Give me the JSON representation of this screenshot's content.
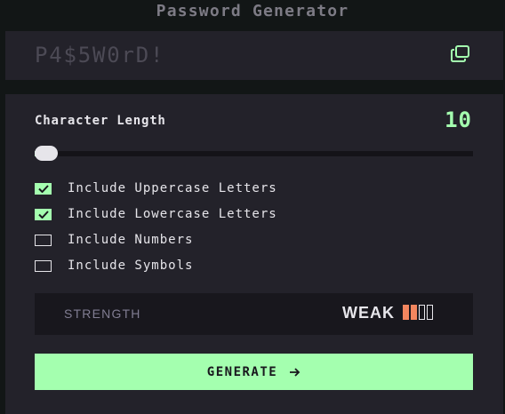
{
  "app": {
    "title": "Password Generator"
  },
  "output": {
    "password": "P4$5W0rD!",
    "copy_icon": "copy-icon"
  },
  "length": {
    "label": "Character Length",
    "value": "10",
    "slider_fraction": 0
  },
  "options": [
    {
      "label": "Include Uppercase Letters",
      "checked": true
    },
    {
      "label": "Include Lowercase Letters",
      "checked": true
    },
    {
      "label": "Include Numbers",
      "checked": false
    },
    {
      "label": "Include Symbols",
      "checked": false
    }
  ],
  "strength": {
    "label": "STRENGTH",
    "value": "WEAK",
    "bars_total": 4,
    "bars_filled": 2,
    "color": "#f3865f"
  },
  "generate": {
    "label": "GENERATE",
    "icon": "arrow-right-icon"
  },
  "colors": {
    "accent": "#a4ffaf",
    "background": "#121616",
    "panel": "#23222a",
    "text": "#e6e5ea",
    "muted": "#817d92"
  }
}
